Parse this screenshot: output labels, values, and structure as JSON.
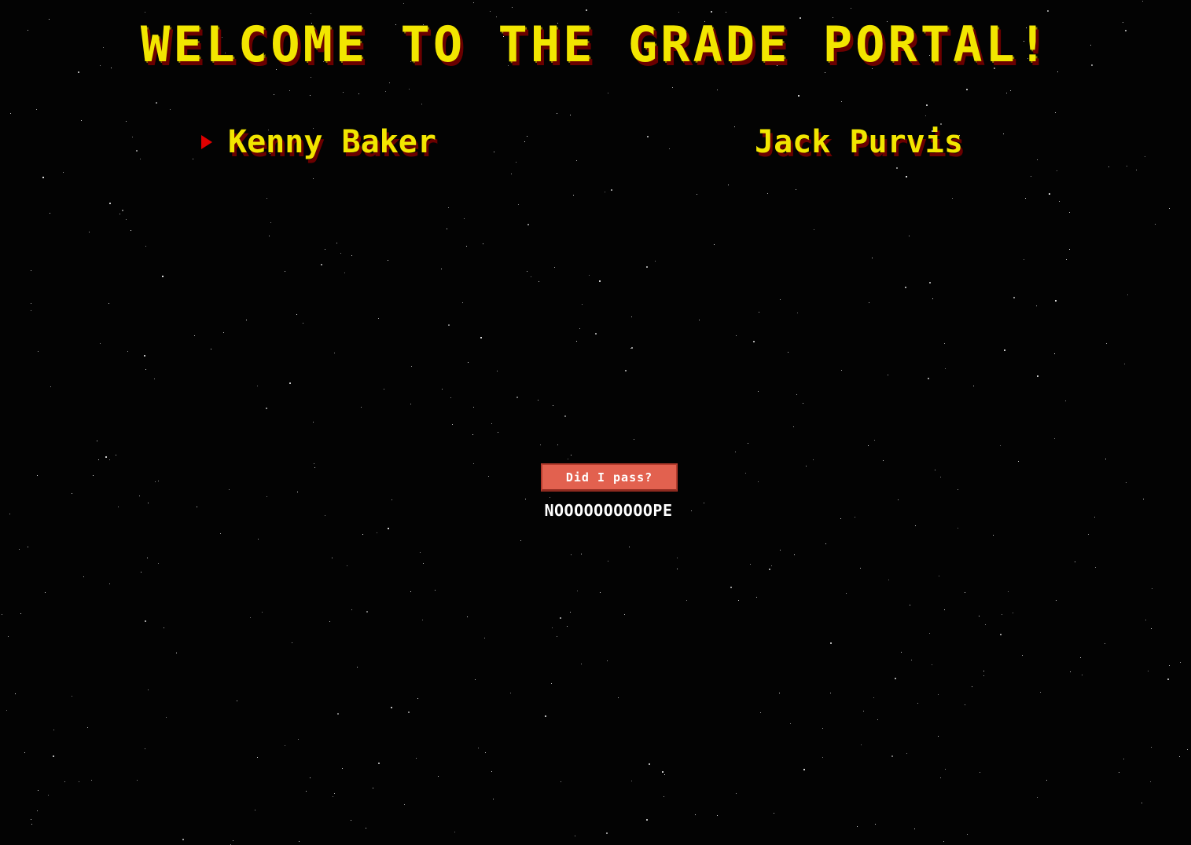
{
  "page": {
    "title": "WELCOME TO THE GRADE PORTAL!"
  },
  "students": [
    {
      "name": "Kenny Baker",
      "selected": true
    },
    {
      "name": "Jack Purvis",
      "selected": false
    }
  ],
  "actions": {
    "pass_button_label": "Did I pass?"
  },
  "result": {
    "text": "NOOOOOOOOOOPE"
  },
  "colors": {
    "background": "#030303",
    "title": "#f2e600",
    "title_shadow": "#6a0000",
    "selector": "#e00000",
    "button": "#e2614f",
    "result_text": "#ffffff"
  },
  "icons": {
    "selector": "triangle-right-icon"
  }
}
